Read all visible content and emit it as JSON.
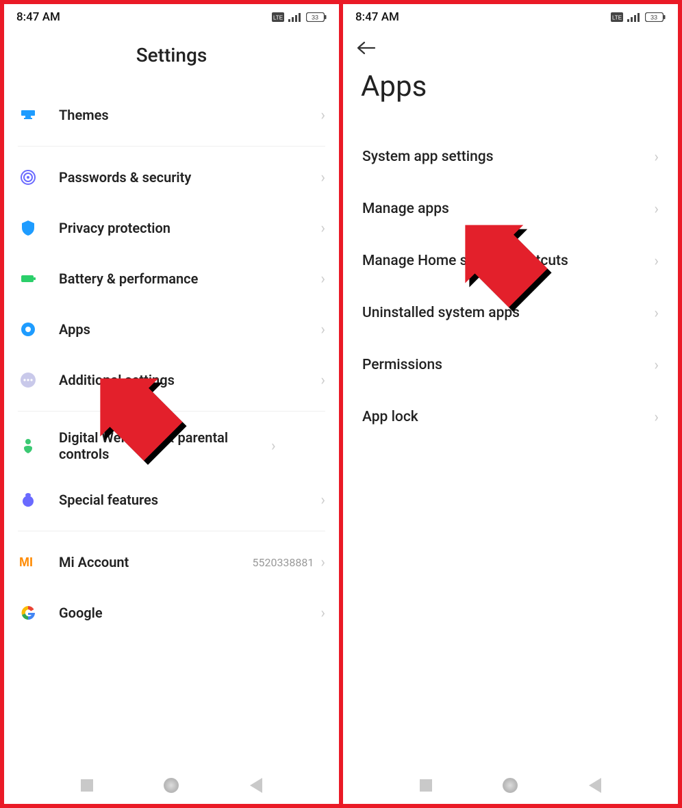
{
  "status": {
    "time": "8:47 AM",
    "battery": "33"
  },
  "left": {
    "title": "Settings",
    "themes": "Themes",
    "passwords": "Passwords & security",
    "privacy": "Privacy protection",
    "battery": "Battery & performance",
    "apps": "Apps",
    "additional": "Additional settings",
    "wellbeing": "Digital Wellbeing & parental controls",
    "special": "Special features",
    "miaccount": "Mi Account",
    "miaccount_value": "5520338881",
    "google": "Google"
  },
  "right": {
    "title": "Apps",
    "system_app": "System app settings",
    "manage_apps": "Manage apps",
    "manage_home": "Manage Home screen shortcuts",
    "uninstalled": "Uninstalled system apps",
    "permissions": "Permissions",
    "app_lock": "App lock"
  }
}
